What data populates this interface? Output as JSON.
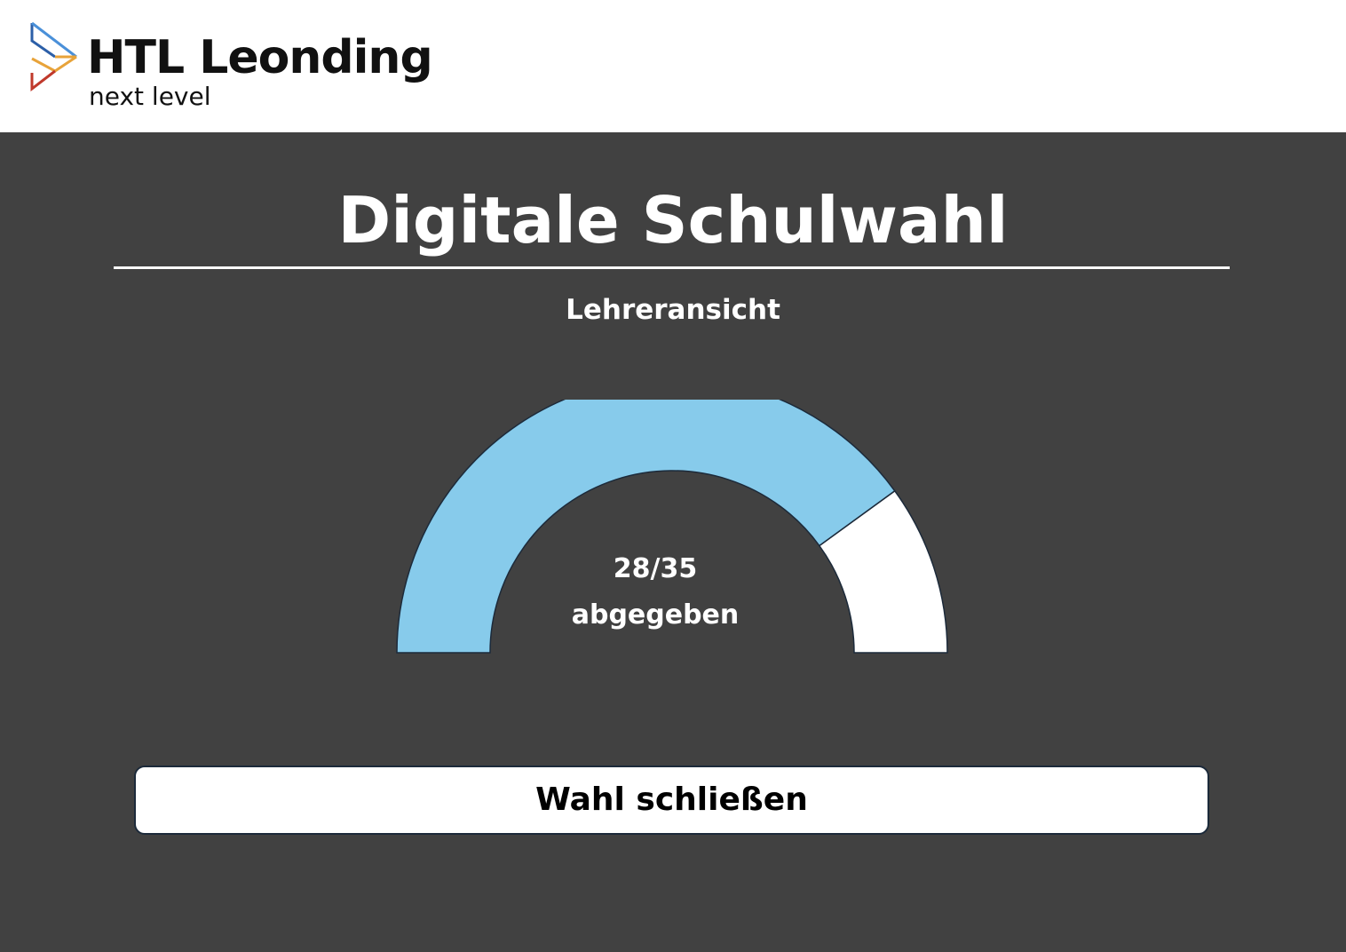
{
  "header": {
    "brand_name": "HTL Leonding",
    "brand_tagline": "next level",
    "logo_icon": "htl-chevron-logo-icon",
    "background": "#ffffff"
  },
  "main": {
    "title": "Digitale Schulwahl",
    "subtitle": "Lehreransicht",
    "background": "#414141"
  },
  "progress": {
    "submitted": 28,
    "total": 35,
    "count_text": "28/35",
    "label": "abgegeben",
    "fill_color": "#87CBEB",
    "remaining_color": "#ffffff"
  },
  "actions": {
    "close_vote_label": "Wahl schließen"
  }
}
